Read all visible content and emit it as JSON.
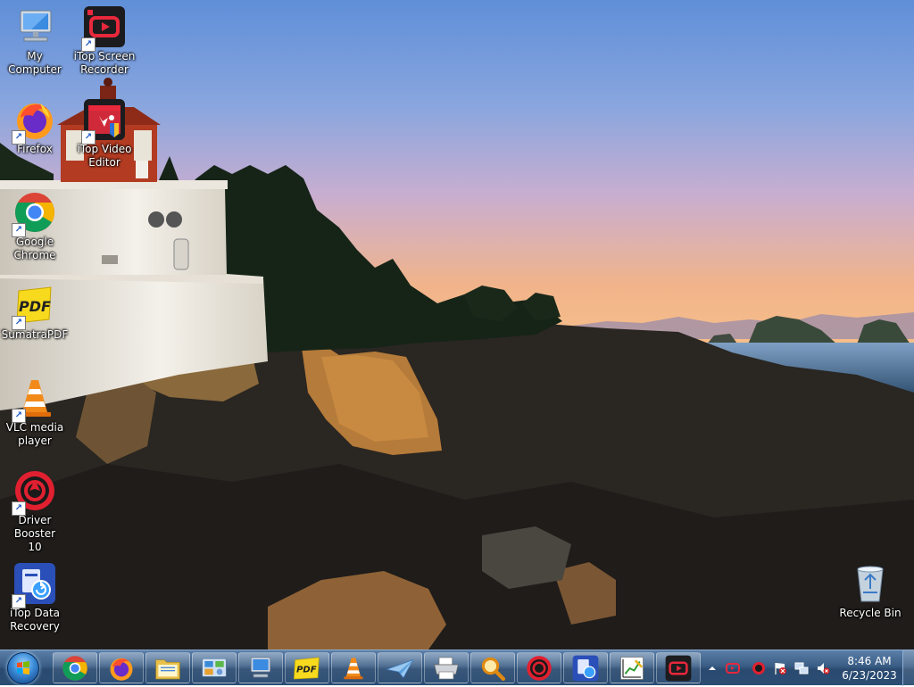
{
  "desktop": {
    "icons": [
      {
        "label": "My Computer",
        "icon": "computer-icon"
      },
      {
        "label": "iTop Screen\nRecorder",
        "icon": "screen-recorder-icon"
      },
      {
        "label": "Firefox",
        "icon": "firefox-icon"
      },
      {
        "label": "iTop Video\nEditor",
        "icon": "video-editor-icon"
      },
      {
        "label": "Google\nChrome",
        "icon": "chrome-icon"
      },
      {
        "label": "SumatraPDF",
        "icon": "pdf-icon"
      },
      {
        "label": "VLC media\nplayer",
        "icon": "vlc-cone-icon"
      },
      {
        "label": "Driver Booster\n10",
        "icon": "driver-booster-icon"
      },
      {
        "label": "iTop Data\nRecovery",
        "icon": "data-recovery-icon"
      },
      {
        "label": "Recycle Bin",
        "icon": "recycle-bin-icon"
      }
    ],
    "sumatra_logo_text": "PDF"
  },
  "taskbar": {
    "pinned": [
      "chrome-icon",
      "firefox-icon",
      "file-explorer-icon",
      "control-panel-icon",
      "computer-icon",
      "pdf-icon",
      "vlc-cone-icon",
      "paper-plane-icon",
      "printer-icon",
      "magnifier-icon",
      "driver-booster-icon",
      "data-recovery-icon",
      "chart-edit-icon",
      "screen-recorder-icon"
    ],
    "pdf_text": "PDF",
    "tray": {
      "icons": [
        "show-hidden-icons-arrow",
        "screen-recorder-tray-icon",
        "driver-booster-tray-icon",
        "action-center-flag-icon",
        "network-icon",
        "volume-muted-icon"
      ],
      "time": "8:46 AM",
      "date": "6/23/2023"
    }
  },
  "colors": {
    "sky_top": "#5f8fd8",
    "sky_bottom": "#f4b88a",
    "taskbar": "#3a5d85",
    "recorder_red": "#e8283c"
  }
}
